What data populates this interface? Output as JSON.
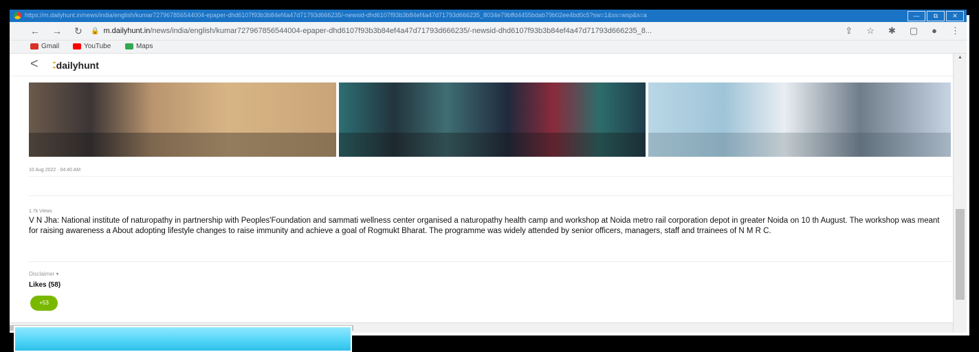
{
  "browser": {
    "title_url": "https://m.dailyhunt.in/news/india/english/kumar727967856544004-epaper-dhd6107f93b3b84ef4a47d71793d666235/-newsid-dhd6107f93b3b84ef4a47d71793d666235_8034e79bffd4455bdab79b02ee4bd0c5?sw=1&ss=wsp&s=a",
    "address_domain": "m.dailyhunt.in",
    "address_path": "/news/india/english/kumar727967856544004-epaper-dhd6107f93b3b84ef4a47d71793d666235/-newsid-dhd6107f93b3b84ef4a47d71793d666235_8...",
    "bookmarks": [
      {
        "label": "Gmail",
        "icon": "gmail-icon",
        "color": "#d93025"
      },
      {
        "label": "YouTube",
        "icon": "youtube-icon",
        "color": "#ff0000"
      },
      {
        "label": "Maps",
        "icon": "maps-icon",
        "color": "#34a853"
      }
    ]
  },
  "site": {
    "logo": "dailyhunt"
  },
  "article": {
    "date": "10 Aug 2022  ·  04:40 AM",
    "views": "1.7k Views",
    "body": "V N Jha: National institute of naturopathy in partnership with Peoples'Foundation and sammati wellness center organised a naturopathy health camp and workshop at Noida metro rail corporation depot in greater Noida on 10 th August. The workshop was meant for raising awareness a About adopting lifestyle changes to raise immunity and achieve a goal of Rogmukt Bharat. The programme was widely attended by senior officers, managers, staff and trrainees of N M R C.",
    "disclaimer": "Disclaimer ▾",
    "likes_label": "Likes (58)",
    "like_badge": "+53"
  },
  "colors": {
    "accent_green": "#7ab800",
    "brand_orange": "#f2a100",
    "highlight_cyan": "#4fd4f7"
  }
}
